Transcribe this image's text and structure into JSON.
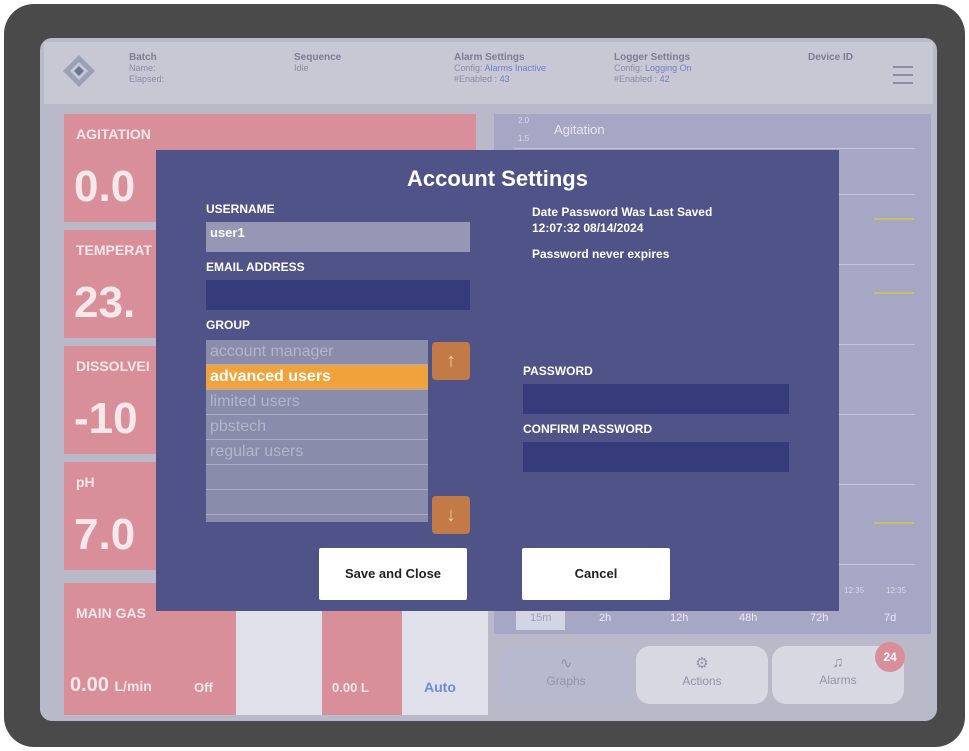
{
  "topbar": {
    "batch": {
      "title": "Batch",
      "name_label": "Name:",
      "elapsed_label": "Elapsed:"
    },
    "sequence": {
      "title": "Sequence",
      "value": "Idle"
    },
    "alarm_settings": {
      "title": "Alarm Settings",
      "config_label": "Config:",
      "config_value": "Alarms Inactive",
      "enabled_label": "#Enabled :",
      "enabled_value": "43"
    },
    "logger_settings": {
      "title": "Logger Settings",
      "config_label": "Config:",
      "config_value": "Logging On",
      "enabled_label": "#Enabled :",
      "enabled_value": "42"
    },
    "device_id": {
      "title": "Device ID"
    }
  },
  "tiles": [
    {
      "label": "AGITATION",
      "value": "0.0"
    },
    {
      "label": "TEMPERAT",
      "value": "23."
    },
    {
      "label": "DISSOLVEI",
      "value": "-10"
    },
    {
      "label": "pH",
      "value": "7.0"
    },
    {
      "label": "MAIN GAS"
    }
  ],
  "graph": {
    "title": "Agitation",
    "y_top": "2.0",
    "y_next": "1.5",
    "time_a": "12:35",
    "time_b": "12:35"
  },
  "ranges": [
    "15m",
    "2h",
    "12h",
    "48h",
    "72h",
    "7d"
  ],
  "bottom": {
    "gas_value": "0.00",
    "gas_unit": "L/min",
    "gas_state": "Off",
    "volume_value": "0.00 L",
    "auto_label": "Auto"
  },
  "nav": {
    "graphs": "Graphs",
    "actions": "Actions",
    "alarms": "Alarms",
    "alarm_count": "24"
  },
  "modal": {
    "title": "Account Settings",
    "username_label": "USERNAME",
    "username_value": "user1",
    "email_label": "EMAIL ADDRESS",
    "email_value": "",
    "group_label": "GROUP",
    "groups": [
      "account manager",
      "advanced users",
      "limited users",
      "pbstech",
      "regular users",
      "",
      "",
      ""
    ],
    "selected_group": "advanced users",
    "date_saved_label": "Date Password Was Last Saved",
    "date_saved_value": "12:07:32 08/14/2024",
    "expiry_text": "Password never expires",
    "password_label": "PASSWORD",
    "confirm_label": "CONFIRM PASSWORD",
    "save_button": "Save and Close",
    "cancel_button": "Cancel"
  },
  "colors": {
    "modal_bg": "#4f5387",
    "field_bg": "#373b79",
    "selected": "#f0a33a",
    "alarm_tile": "#d98f99"
  },
  "icons": {
    "logo": "diamond-logo-icon",
    "menu": "hamburger-menu-icon",
    "up": "arrow-up-icon",
    "down": "arrow-down-icon",
    "graphs": "pulse-icon",
    "actions": "gear-icon",
    "alarms": "bell-icon"
  }
}
